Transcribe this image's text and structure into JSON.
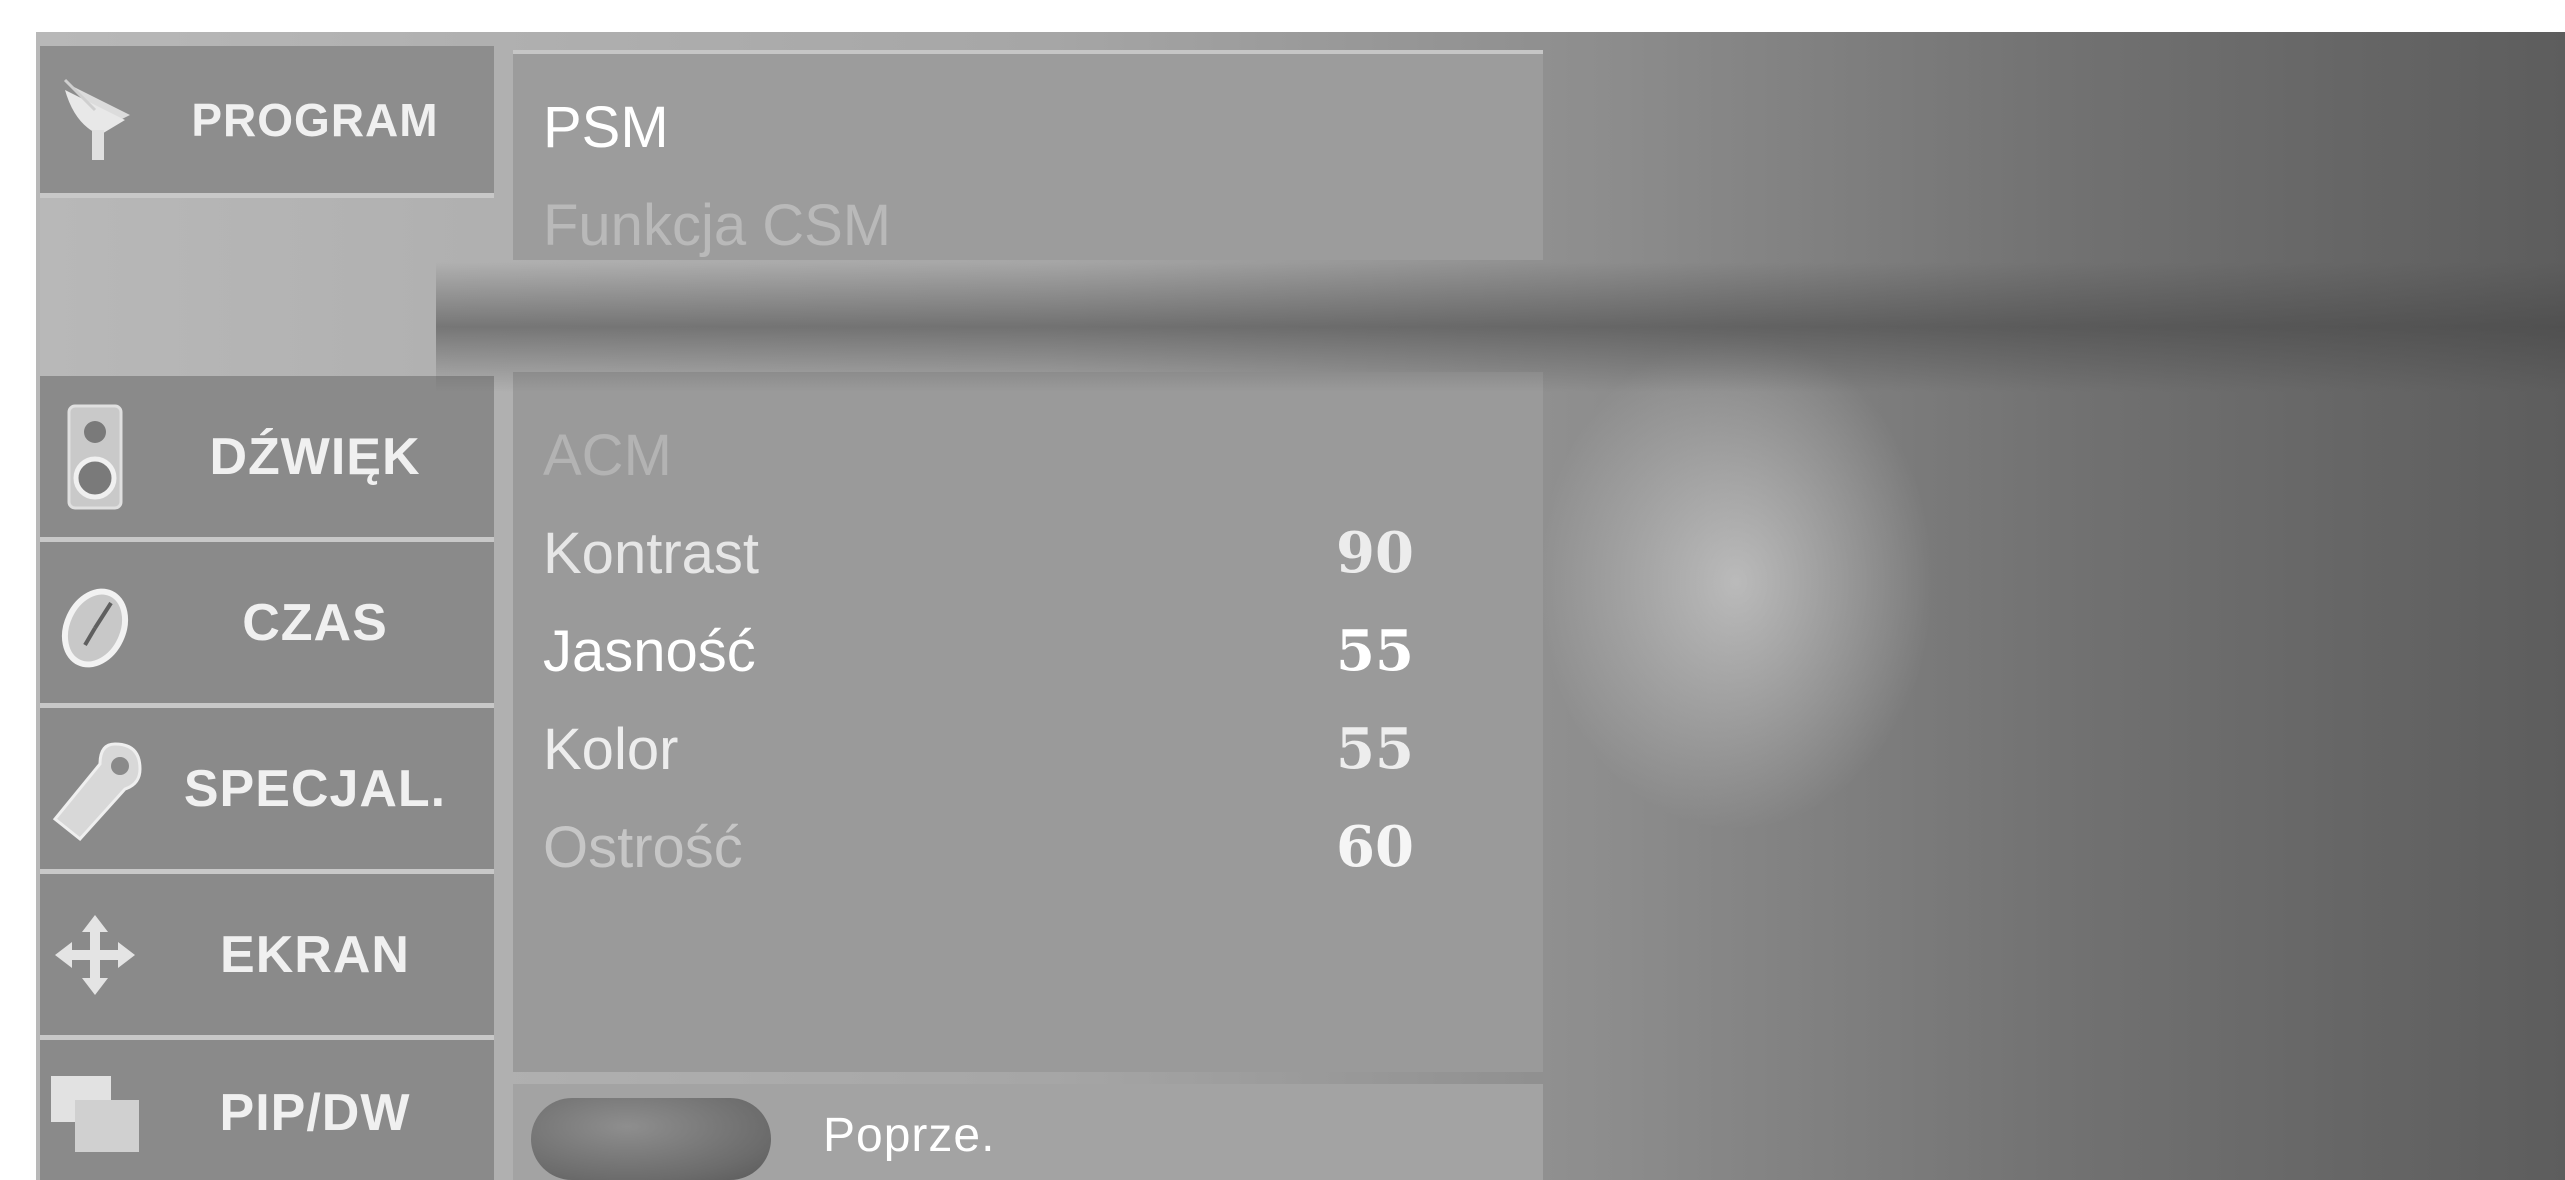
{
  "sidebar": {
    "items": [
      {
        "label": "PROGRAM",
        "icon": "satellite-dish-icon"
      },
      {
        "label": "DŹWIĘK",
        "icon": "speaker-icon"
      },
      {
        "label": "CZAS",
        "icon": "clock-icon"
      },
      {
        "label": "SPECJAL.",
        "icon": "tag-icon"
      },
      {
        "label": "EKRAN",
        "icon": "move-arrows-icon"
      },
      {
        "label": "PIP/DW",
        "icon": "pip-windows-icon"
      }
    ]
  },
  "picture_menu": {
    "top_items": [
      {
        "label": "PSM"
      },
      {
        "label": "Funkcja CSM"
      }
    ],
    "items": [
      {
        "label": "ACM",
        "value": ""
      },
      {
        "label": "Kontrast",
        "value": "90"
      },
      {
        "label": "Jasność",
        "value": "55"
      },
      {
        "label": "Kolor",
        "value": "55"
      },
      {
        "label": "Ostrość",
        "value": "60"
      }
    ]
  },
  "footer": {
    "prev_label": "Poprze."
  },
  "colors": {
    "panel": "#9a9a9a",
    "sidebar": "#8a8a8a",
    "text": "#ffffff"
  }
}
